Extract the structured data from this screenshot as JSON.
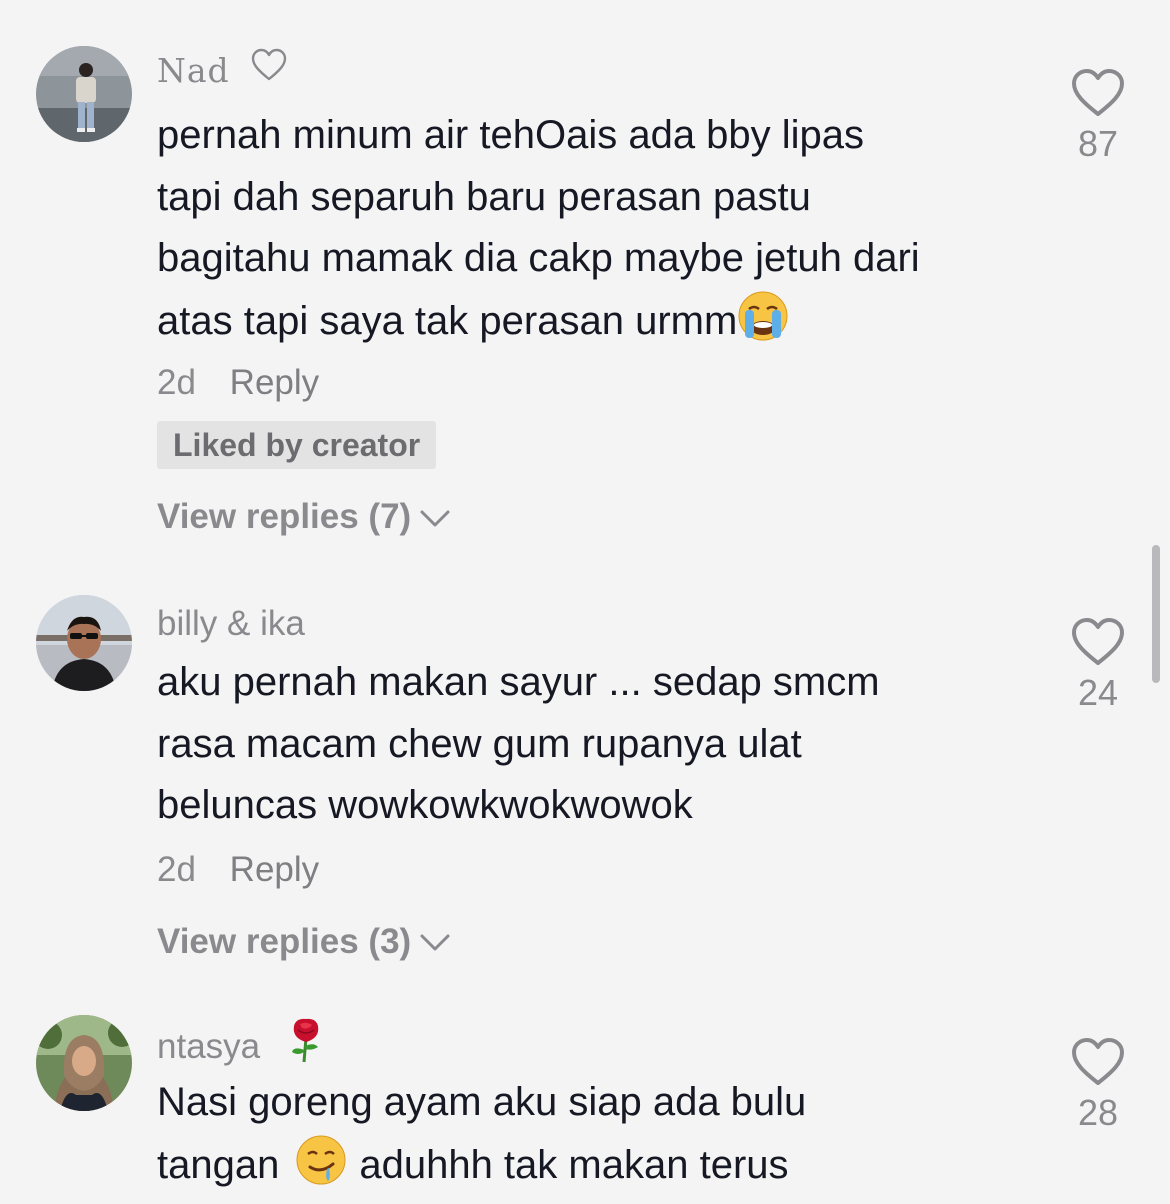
{
  "comments": [
    {
      "username": "Nad",
      "lines": [
        "pernah minum air tehOais ada bby lipas",
        "tapi dah separuh baru perasan pastu",
        "bagitahu mamak dia cakp maybe jetuh dari",
        "atas tapi saya tak perasan urmm"
      ],
      "time": "2d",
      "reply_label": "Reply",
      "badge": "Liked by creator",
      "view_replies": "View replies (7)",
      "likes": "87"
    },
    {
      "username": "billy & ika",
      "lines": [
        "aku pernah makan sayur ... sedap smcm",
        "rasa macam chew gum rupanya ulat",
        "beluncas wowkowkwokwowok"
      ],
      "time": "2d",
      "reply_label": "Reply",
      "view_replies": "View replies (3)",
      "likes": "24"
    },
    {
      "username": "ntasya",
      "lines": [
        "Nasi goreng ayam aku siap ada bulu",
        "tangan",
        "aduhhh tak makan terus"
      ],
      "likes": "28"
    }
  ],
  "icons": {
    "name_decoration_1": "heart-outline-icon",
    "name_decoration_3": "rose-icon",
    "emoji_1": "loudly-crying-face-emoji",
    "emoji_3": "drooling-face-emoji",
    "like": "heart-outline-icon",
    "expand": "chevron-down-icon"
  },
  "colors": {
    "background": "#f4f4f4",
    "text": "#161823",
    "secondary": "#8a8a8e",
    "badge_bg": "#e3e3e3"
  }
}
